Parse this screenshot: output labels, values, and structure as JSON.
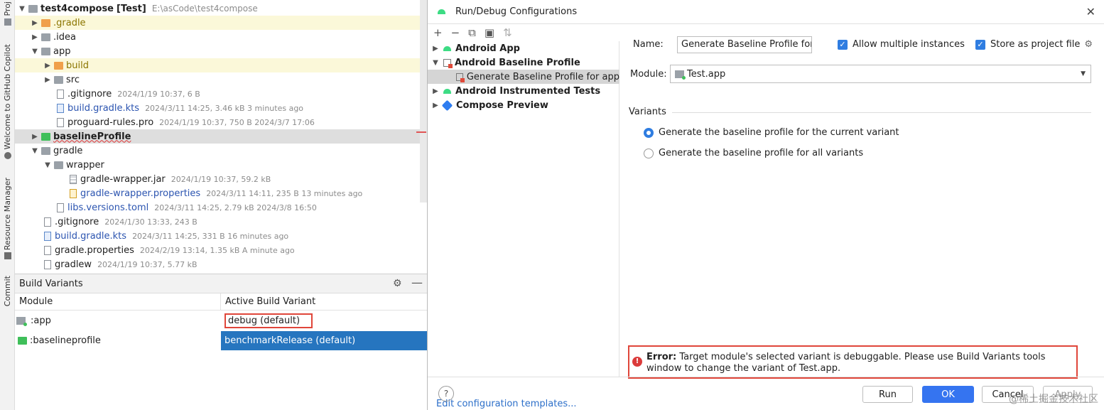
{
  "strip": {
    "top_label": "Proj",
    "copilot_label": "Welcome to GitHub Copilot",
    "resource_label": "Resource Manager",
    "commit_label": "Commit"
  },
  "tree": {
    "root": {
      "name": "test4compose",
      "tag": "[Test]",
      "path": "E:\\asCode\\test4compose"
    },
    "items": [
      {
        "name": ".gradle",
        "meta": ""
      },
      {
        "name": ".idea",
        "meta": ""
      },
      {
        "name": "app",
        "meta": ""
      },
      {
        "name": "build",
        "meta": ""
      },
      {
        "name": "src",
        "meta": ""
      },
      {
        "name": ".gitignore",
        "meta": "2024/1/19 10:37, 6 B"
      },
      {
        "name": "build.gradle.kts",
        "meta": "2024/3/11 14:25, 3.46 kB 3 minutes ago"
      },
      {
        "name": "proguard-rules.pro",
        "meta": "2024/1/19 10:37, 750 B 2024/3/7 17:06"
      },
      {
        "name": "baselineProfile",
        "meta": ""
      },
      {
        "name": "gradle",
        "meta": ""
      },
      {
        "name": "wrapper",
        "meta": ""
      },
      {
        "name": "gradle-wrapper.jar",
        "meta": "2024/1/19 10:37, 59.2 kB"
      },
      {
        "name": "gradle-wrapper.properties",
        "meta": "2024/3/11 14:11, 235 B 13 minutes ago"
      },
      {
        "name": "libs.versions.toml",
        "meta": "2024/3/11 14:25, 2.79 kB 2024/3/8 16:50"
      },
      {
        "name": ".gitignore",
        "meta": "2024/1/30 13:33, 243 B"
      },
      {
        "name": "build.gradle.kts",
        "meta": "2024/3/11 14:25, 331 B 16 minutes ago"
      },
      {
        "name": "gradle.properties",
        "meta": "2024/2/19 13:14, 1.35 kB A minute ago"
      },
      {
        "name": "gradlew",
        "meta": "2024/1/19 10:37, 5.77 kB"
      }
    ]
  },
  "build_variants": {
    "title": "Build Variants",
    "columns": [
      "Module",
      "Active Build Variant"
    ],
    "rows": [
      {
        "module": ":app",
        "variant": "debug (default)"
      },
      {
        "module": ":baselineprofile",
        "variant": "benchmarkRelease (default)"
      }
    ]
  },
  "dialog": {
    "title": "Run/Debug Configurations",
    "close_glyph": "✕",
    "toolbar": [
      "+",
      "−",
      "⧉",
      "▣",
      "⇅"
    ],
    "config_items": [
      {
        "label": "Android App"
      },
      {
        "label": "Android Baseline Profile"
      },
      {
        "label": "Generate Baseline Profile for app"
      },
      {
        "label": "Android Instrumented Tests"
      },
      {
        "label": "Compose Preview"
      }
    ],
    "edit_templates": "Edit configuration templates...",
    "name_label": "Name:",
    "name_value": "Generate Baseline Profile for app",
    "allow_multiple": "Allow multiple instances",
    "store_project": "Store as project file",
    "module_label": "Module:",
    "module_value": "Test.app",
    "variants_title": "Variants",
    "radio_current": "Generate the baseline profile for the current variant",
    "radio_all": "Generate the baseline profile for all variants",
    "error_label": "Error:",
    "error_text": "Target module's selected variant is debuggable. Please use Build Variants tools window to change the variant of Test.app.",
    "help": "?",
    "buttons": {
      "run": "Run",
      "ok": "OK",
      "cancel": "Cancel",
      "apply": "Apply"
    }
  },
  "watermark": "@稀土掘金技术社区",
  "colors": {
    "accent": "#3574f0",
    "selection": "#2675bf",
    "error": "#db3b3b",
    "highlight_border": "#e0463a"
  }
}
